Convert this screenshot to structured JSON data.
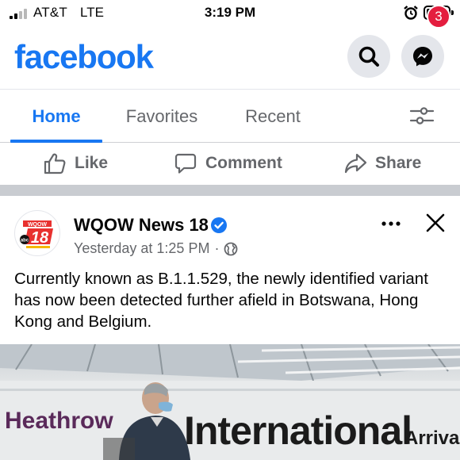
{
  "status_bar": {
    "carrier": "AT&T",
    "network": "LTE",
    "time": "3:19 PM",
    "icons": [
      "signal-icon",
      "alarm-icon",
      "battery-icon"
    ]
  },
  "header": {
    "logo": "facebook",
    "messenger_badge": "3",
    "icons": [
      "search-icon",
      "messenger-icon"
    ]
  },
  "tabs": {
    "items": [
      {
        "label": "Home",
        "active": true
      },
      {
        "label": "Favorites",
        "active": false
      },
      {
        "label": "Recent",
        "active": false
      }
    ],
    "filter_icon": "filter-sliders-icon"
  },
  "reactions": {
    "like_label": "Like",
    "comment_label": "Comment",
    "share_label": "Share"
  },
  "post": {
    "page_name": "WQOW News 18",
    "timestamp": "Yesterday at 1:25 PM",
    "separator": "·",
    "privacy_icon": "globe-icon",
    "avatar_logo": "WQOW 18 abc",
    "text": "Currently known as B.1.1.529, the newly identified variant has now been detected further afield in Botswana, Hong Kong and Belgium.",
    "photo": {
      "sign_left": "Heathrow",
      "sign_main": "International",
      "sign_sub": "Arrivals"
    }
  },
  "colors": {
    "brand": "#1877f2",
    "badge": "#e41e3f",
    "secondary_text": "#65676b",
    "separator": "#c9ccd1"
  }
}
